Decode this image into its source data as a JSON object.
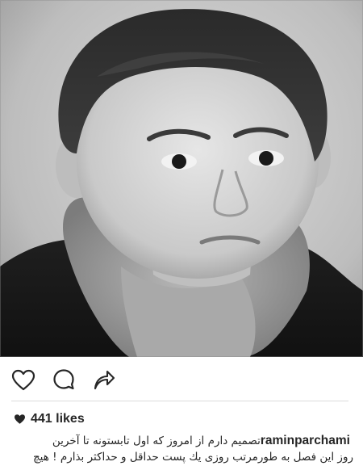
{
  "post": {
    "likes": "441 likes",
    "username": "raminparchami",
    "caption_line1": "تصمیم دارم از امروز که اول تابستونه تا آخرین",
    "caption_line2": "روز این فصل به طورمرتب روزی یك پست حداقل و حداكثر بذارم ! هیچ"
  },
  "icons": {
    "like": "heart-outline-icon",
    "comment": "speech-bubble-icon",
    "share": "share-arrow-icon",
    "likes_heart": "heart-filled-icon"
  },
  "colors": {
    "text": "#262626",
    "divider": "#dbdbdb",
    "background": "#ffffff"
  }
}
